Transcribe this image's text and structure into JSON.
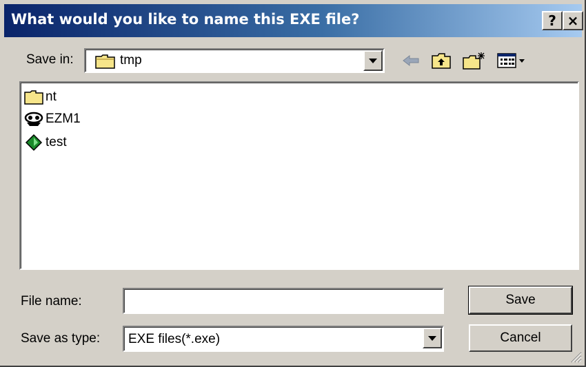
{
  "window": {
    "title": "What would you like to name this EXE file?"
  },
  "titlebar_buttons": {
    "help": "?",
    "close": "×"
  },
  "save_in": {
    "label": "Save in:",
    "value": "tmp"
  },
  "toolbar": [
    "back-icon",
    "up-folder-icon",
    "new-folder-icon",
    "views-menu-icon"
  ],
  "files": [
    {
      "name": "nt",
      "icon": "folder-icon"
    },
    {
      "name": "EZM1",
      "icon": "program-icon"
    },
    {
      "name": "test",
      "icon": "executable-icon"
    }
  ],
  "file_name": {
    "label": "File name:",
    "value": ""
  },
  "save_as_type": {
    "label": "Save as type:",
    "value": "EXE files(*.exe)"
  },
  "buttons": {
    "save": "Save",
    "cancel": "Cancel"
  },
  "colors": {
    "title_start": "#0a246a",
    "title_end": "#a6caf0",
    "face": "#d4d0c8"
  }
}
